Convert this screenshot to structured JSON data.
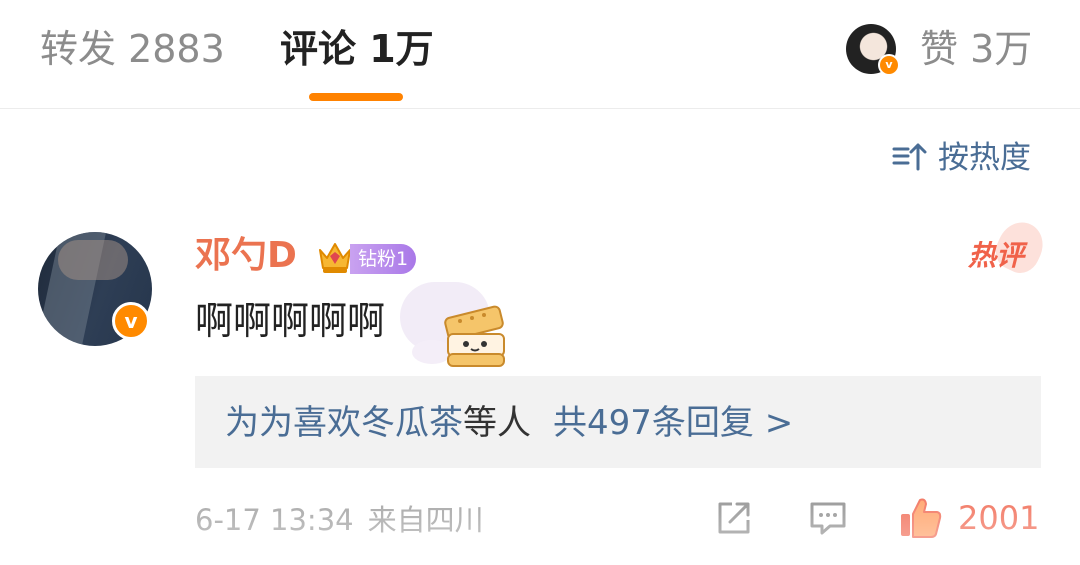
{
  "tabs": {
    "repost": "转发 2883",
    "comments": "评论 1万",
    "likes": "赞 3万"
  },
  "sort": {
    "label": "按热度"
  },
  "comment": {
    "username": "邓勺D",
    "fan_badge": "钻粉1",
    "hot_badge": "热评",
    "text": "啊啊啊啊啊",
    "replies": {
      "names": "为为喜欢冬瓜茶",
      "suffix": "等人",
      "count_label": "共497条回复 >"
    },
    "date": "6-17 13:34",
    "location": "来自四川",
    "like_count": "2001"
  },
  "colors": {
    "accent": "#ff8200",
    "link_blue": "#4a6d95",
    "username": "#eb7350",
    "like": "#f0624a"
  }
}
